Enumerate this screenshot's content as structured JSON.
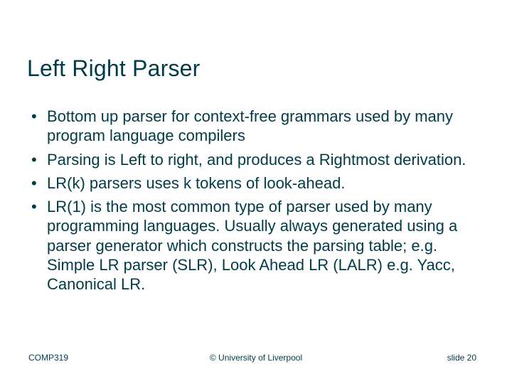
{
  "title": "Left Right Parser",
  "bullets": [
    "Bottom up parser for context-free grammars used by many program language compilers",
    "Parsing is Left to right, and produces a Rightmost derivation.",
    "LR(k) parsers uses k tokens of look-ahead.",
    "LR(1) is the most common type of parser used by many programming languages. Usually always generated using a parser generator which constructs the parsing table; e.g. Simple LR parser (SLR), Look Ahead LR (LALR) e.g. Yacc, Canonical LR."
  ],
  "footer": {
    "course": "COMP319",
    "copyright": "© University of Liverpool",
    "slide_label": "slide  20"
  }
}
